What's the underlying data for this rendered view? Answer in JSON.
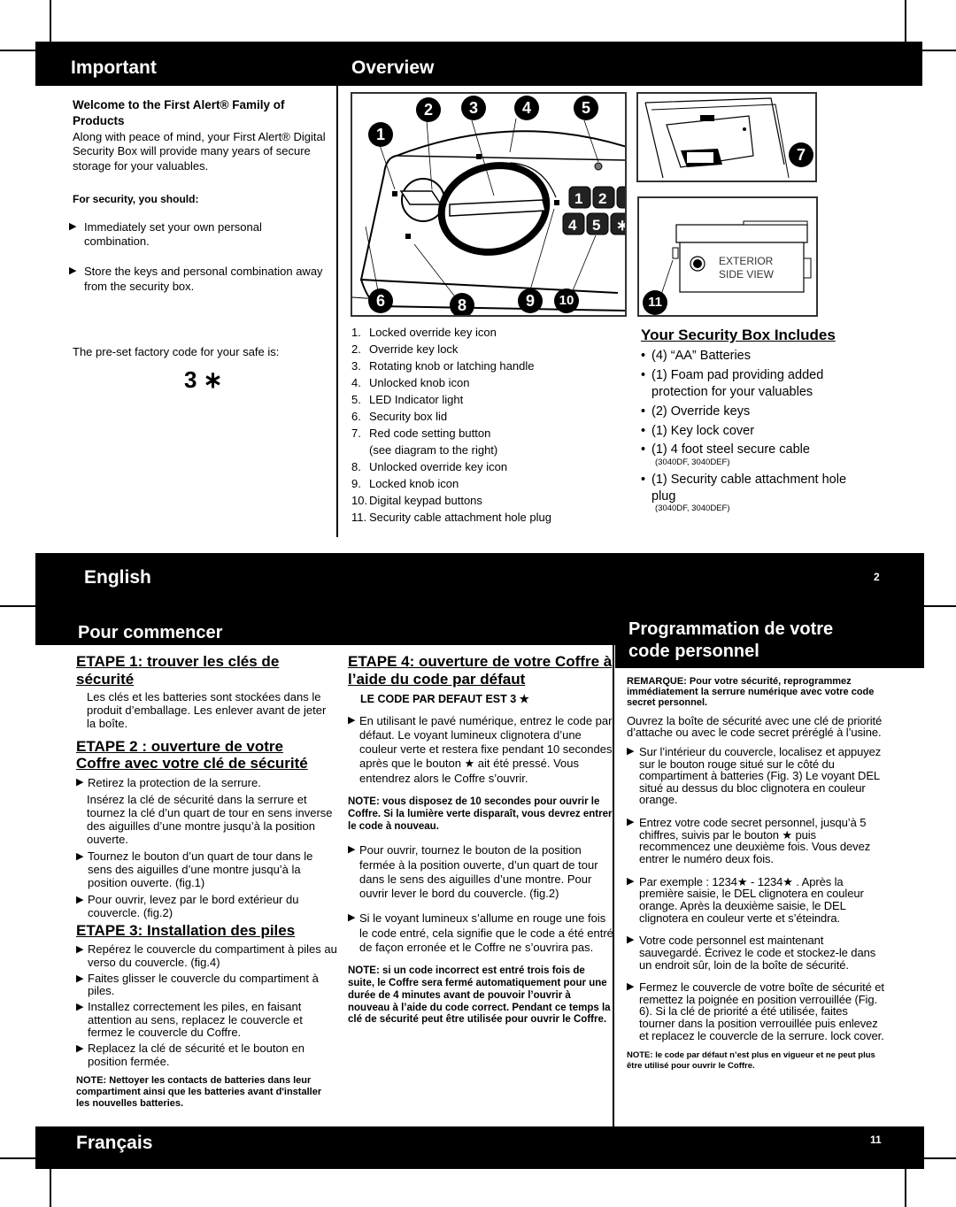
{
  "page_top": {
    "important": {
      "title": "Important",
      "welcome_heading": "Welcome to the First Alert® Family of Products",
      "welcome_text": "Along with peace of mind, your First Alert® Digital Security Box will provide many years of secure storage for your valuables.",
      "security_heading": "For security, you should:",
      "security_items": [
        "Immediately set your own personal combination.",
        "Store the keys and personal combination away from the security box."
      ],
      "factory_code_label": "The pre-set factory code for your safe is:",
      "factory_code": "3 ∗"
    },
    "overview": {
      "title": "Overview",
      "callouts": [
        "1",
        "2",
        "3",
        "4",
        "5",
        "6",
        "7",
        "8",
        "9",
        "10",
        "11"
      ],
      "keypad_keys": [
        "1",
        "2",
        "4",
        "5",
        "∗"
      ],
      "side_view_label_1": "EXTERIOR",
      "side_view_label_2": "SIDE VIEW",
      "legend": [
        {
          "num": "1.",
          "text": "Locked override key icon"
        },
        {
          "num": "2.",
          "text": "Override key lock"
        },
        {
          "num": "3.",
          "text": "Rotating knob or latching handle"
        },
        {
          "num": "4.",
          "text": "Unlocked knob icon"
        },
        {
          "num": "5.",
          "text": "LED Indicator light"
        },
        {
          "num": "6.",
          "text": "Security box lid"
        },
        {
          "num": "7.",
          "text": "Red code setting button"
        },
        {
          "num": "",
          "text": "(see diagram to the right)"
        },
        {
          "num": "8.",
          "text": "Unlocked override key icon"
        },
        {
          "num": "9.",
          "text": "Locked knob icon"
        },
        {
          "num": "10.",
          "text": "Digital keypad buttons"
        },
        {
          "num": "11.",
          "text": "Security cable attachment hole plug"
        }
      ],
      "includes_heading": "Your Security Box Includes",
      "includes": [
        {
          "text": "(4) “AA” Batteries",
          "sub": ""
        },
        {
          "text": "(1) Foam pad providing added protection for your valuables",
          "sub": ""
        },
        {
          "text": "(2) Override keys",
          "sub": ""
        },
        {
          "text": "(1) Key lock cover",
          "sub": ""
        },
        {
          "text": "(1) 4 foot steel secure cable",
          "sub": "(3040DF, 3040DEF)"
        },
        {
          "text": "(1) Security cable attachment hole plug",
          "sub": "(3040DF, 3040DEF)"
        }
      ]
    },
    "footer": {
      "language": "English",
      "page_number": "2"
    }
  },
  "page_bottom": {
    "pour_commencer": {
      "title": "Pour commencer",
      "etape1": {
        "heading": "ETAPE 1: trouver les clés de sécurité",
        "text": "Les clés et les batteries sont stockées dans le produit d’emballage. Les enlever avant de jeter la boîte."
      },
      "etape2": {
        "heading": "ETAPE 2 : ouverture de votre Coffre avec votre clé de sécurité",
        "item1": "Retirez la protection de la serrure.",
        "item1_cont": "Insérez la clé de sécurité dans la serrure et tournez la clé d’un quart de tour en sens inverse des aiguilles d’une montre jusqu’à la position ouverte.",
        "item2": "Tournez le bouton d’un quart de tour dans le sens des aiguilles d’une montre jusqu’à la position ouverte. (fig.1)",
        "item3": "Pour ouvrir, levez par le bord extérieur du couvercle. (fig.2)"
      },
      "etape3": {
        "heading": "ETAPE 3: Installation des piles",
        "items": [
          "Repérez le couvercle du compartiment à piles au verso du couvercle. (fig.4)",
          "Faites glisser le couvercle du compartiment à piles.",
          "Installez correctement les piles, en faisant attention au sens, replacez le couvercle et fermez le couvercle du Coffre.",
          "Replacez la clé de sécurité et le bouton en position fermée."
        ],
        "note": "NOTE: Nettoyer les contacts de batteries dans leur compartiment ainsi que les batteries avant d'installer les nouvelles batteries."
      },
      "etape4": {
        "heading": "ETAPE 4: ouverture de votre Coffre à l’aide du code par défaut",
        "code_line": "LE CODE PAR DEFAUT EST 3 ★",
        "item1": "En utilisant le pavé numérique, entrez le code par défaut. Le voyant lumineux clignotera d’une couleur verte et restera fixe pendant 10 secondes après que le bouton ★ ait été pressé. Vous entendrez alors le Coffre s’ouvrir.",
        "note1": "NOTE: vous disposez de 10 secondes pour ouvrir le Coffre. Si la lumière verte disparaît, vous devrez entrer le code à nouveau.",
        "item2": "Pour ouvrir, tournez le bouton de la position fermée à la position ouverte, d’un quart de tour dans le sens des aiguilles d’une montre. Pour ouvrir lever le bord du couvercle. (fig.2)",
        "item3": "Si le voyant lumineux s’allume en rouge une fois le code entré, cela signifie que le code a été entré de façon erronée et le Coffre ne s’ouvrira pas.",
        "note2": "NOTE: si un code incorrect est entré trois fois de suite, le Coffre sera fermé automatiquement pour une durée de 4 minutes avant de pouvoir l’ouvrir à nouveau à l’aide du code correct. Pendant ce temps la clé de sécurité peut être utilisée pour ouvrir le Coffre."
      }
    },
    "programmation": {
      "title_line1": "Programmation de votre",
      "title_line2": "code personnel",
      "remarque": "REMARQUE: Pour votre sécurité, reprogrammez immédiatement la serrure numérique avec votre code secret personnel.",
      "intro": "Ouvrez la boîte de sécurité avec une clé de priorité d’attache ou avec le code secret préréglé à l’usine.",
      "items": [
        "Sur l’intérieur du couvercle, localisez et appuyez sur le bouton rouge situé sur le côté du compartiment à batteries (Fig. 3) Le voyant DEL situé au dessus du bloc clignotera en couleur orange.",
        "Entrez votre code secret personnel, jusqu’à 5 chiffres, suivis par le bouton ★ puis recommencez une deuxième fois. Vous devez entrer le numéro deux fois.",
        "Par exemple : 1234★ - 1234★ . Après la première saisie, le DEL clignotera en couleur orange. Après la deuxième saisie, le DEL clignotera en couleur verte et s’éteindra.",
        "Votre code personnel est maintenant sauvegardé.  Écrivez le code et stockez-le dans un endroit sûr, loin de la boîte de sécurité.",
        "Fermez le couvercle de votre boîte de sécurité et remettez la poignée en position verrouillée (Fig. 6).  Si la clé de priorité a été utilisée, faites tourner dans la position verrouillée puis enlevez et replacez le couvercle de la serrure. lock cover."
      ],
      "note": "NOTE: le code par défaut n’est plus en vigueur et ne peut plus être utilisé pour ouvrir le Coffre."
    },
    "footer": {
      "language": "Français",
      "page_number": "11"
    }
  },
  "bullet_arrow": "▶"
}
